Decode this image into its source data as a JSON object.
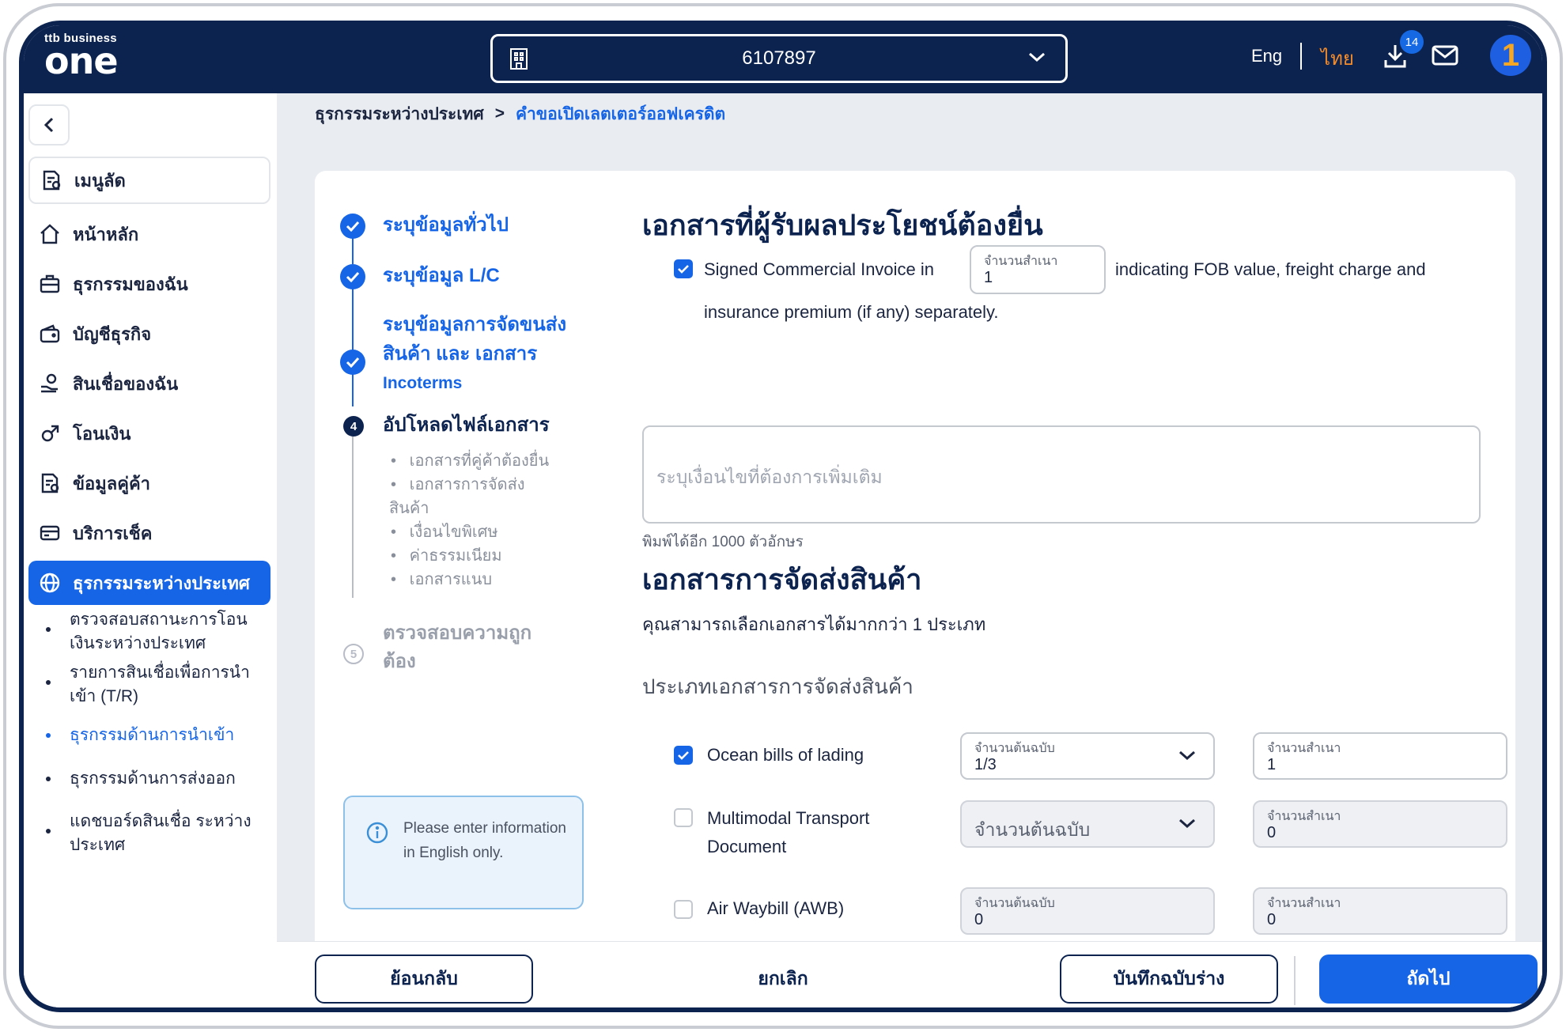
{
  "header": {
    "logo_small": "ttb business",
    "logo_big": "one",
    "account_number": "6107897",
    "lang_eng": "Eng",
    "lang_thai": "ไทย",
    "download_badge": "14",
    "avatar_glyph": "1"
  },
  "sidebar": {
    "shortcut_label": "เมนูลัด",
    "items": [
      {
        "label": "หน้าหลัก",
        "icon": "home-icon"
      },
      {
        "label": "ธุรกรรมของฉัน",
        "icon": "briefcase-icon"
      },
      {
        "label": "บัญชีธุรกิจ",
        "icon": "wallet-icon"
      },
      {
        "label": "สินเชื่อของฉัน",
        "icon": "loan-icon"
      },
      {
        "label": "โอนเงิน",
        "icon": "transfer-icon"
      },
      {
        "label": "ข้อมูลคู่ค้า",
        "icon": "partner-icon"
      },
      {
        "label": "บริการเช็ค",
        "icon": "cheque-icon"
      },
      {
        "label": "ธุรกรรมระหว่างประเทศ",
        "icon": "globe-icon",
        "active": true
      }
    ],
    "sub_items": [
      {
        "label": "ตรวจสอบสถานะการโอนเงินระหว่างประเทศ"
      },
      {
        "label": "รายการสินเชื่อเพื่อการนำเข้า (T/R)"
      },
      {
        "label": "ธุรกรรมด้านการนำเข้า",
        "active": true
      },
      {
        "label": "ธุรกรรมด้านการส่งออก"
      },
      {
        "label": "แดชบอร์ดสินเชื่อ ระหว่างประเทศ"
      }
    ]
  },
  "breadcrumb": {
    "parent": "ธุรกรรมระหว่างประเทศ",
    "separator": ">",
    "current": "คำขอเปิดเลตเตอร์ออฟเครดิต"
  },
  "stepper": {
    "step1": "ระบุข้อมูลทั่วไป",
    "step2": "ระบุข้อมูล L/C",
    "step3_line1": "ระบุข้อมูลการจัดขนส่ง",
    "step3_line2": "สินค้า และ เอกสาร",
    "step3_line3": "Incoterms",
    "step4_num": "4",
    "step4": "อัปโหลดไฟล์เอกสาร",
    "step4_subs": [
      "เอกสารที่คู่ค้าต้องยื่น",
      "เอกสารการจัดส่ง",
      "สินค้า",
      "เงื่อนไขพิเศษ",
      "ค่าธรรมเนียม",
      "เอกสารแนบ"
    ],
    "step5_num": "5",
    "step5_line1": "ตรวจสอบความถูก",
    "step5_line2": "ต้อง"
  },
  "info_box": {
    "text": "Please enter information in English only."
  },
  "beneficiary_docs": {
    "title": "เอกสารที่ผู้รับผลประโยชน์ต้องยื่น",
    "invoice_text_before": "Signed Commercial Invoice in",
    "copies_label": "จำนวนสำเนา",
    "copies_value": "1",
    "invoice_text_after": "indicating FOB value, freight charge and",
    "invoice_text_line2": "insurance premium (if any) separately.",
    "textarea_placeholder": "ระบุเงื่อนไขที่ต้องการเพิ่มเติม",
    "char_counter": "พิมพ์ได้อีก 1000 ตัวอักษร"
  },
  "shipping_docs": {
    "title": "เอกสารการจัดส่งสินค้า",
    "subtitle": "คุณสามารถเลือกเอกสารได้มากกว่า 1 ประเภท",
    "type_heading": "ประเภทเอกสารการจัดส่งสินค้า",
    "rows": [
      {
        "name": "Ocean bills of lading",
        "checked": true,
        "original_label": "จำนวนต้นฉบับ",
        "original_value": "1/3",
        "copies_label": "จำนวนสำเนา",
        "copies_value": "1"
      },
      {
        "name_line1": "Multimodal Transport",
        "name_line2": "Document",
        "checked": false,
        "original_placeholder": "จำนวนต้นฉบับ",
        "copies_label": "จำนวนสำเนา",
        "copies_value": "0"
      },
      {
        "name": "Air Waybill (AWB)",
        "checked": false,
        "original_label": "จำนวนต้นฉบับ",
        "original_value": "0",
        "copies_label": "จำนวนสำเนา",
        "copies_value": "0"
      }
    ]
  },
  "footer": {
    "back": "ย้อนกลับ",
    "cancel": "ยกเลิก",
    "save_draft": "บันทึกฉบับร่าง",
    "next": "ถัดไป"
  },
  "colors": {
    "navy": "#0c2350",
    "primary": "#1565e6",
    "accent_orange": "#f28b2b"
  }
}
